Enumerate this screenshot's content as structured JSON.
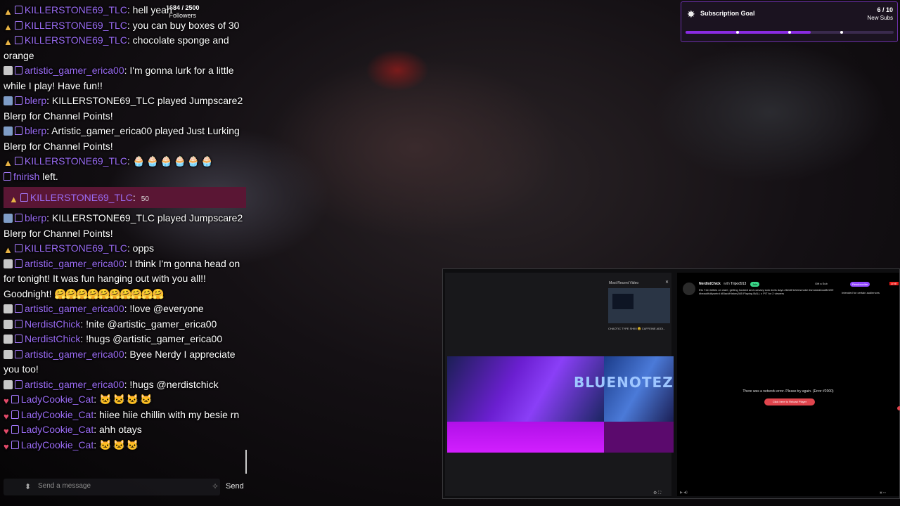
{
  "followers": {
    "count": "1684 / 2500",
    "label": "Followers"
  },
  "goal": {
    "title": "Subscription Goal",
    "count": "6 / 10",
    "label": "New Subs",
    "progress": 0.6
  },
  "chat": {
    "m1": {
      "name": "KILLERSTONE69_TLC",
      "text": ": hell yeah"
    },
    "m2": {
      "name": "KILLERSTONE69_TLC",
      "text": ": you can buy boxes of 30"
    },
    "m3": {
      "name": "KILLERSTONE69_TLC",
      "text": ": chocolate sponge and orange"
    },
    "m4": {
      "name": "artistic_gamer_erica00",
      "text": ": I'm gonna lurk for a little while I play! Have fun!!"
    },
    "m5": {
      "name": "blerp",
      "text": ": KILLERSTONE69_TLC played Jumpscare2 Blerp for Channel Points!"
    },
    "m6": {
      "name": "blerp",
      "text": ": Artistic_gamer_erica00 played Just Lurking Blerp for Channel Points!"
    },
    "m7": {
      "name": "KILLERSTONE69_TLC",
      "text": ":",
      "emotes": "🧁🧁🧁🧁🧁🧁"
    },
    "m8": {
      "name": "fnirish",
      "text": " left."
    },
    "hl": {
      "name": "KILLERSTONE69_TLC",
      "text": ":",
      "amount": "50"
    },
    "m9": {
      "name": "blerp",
      "text": ": KILLERSTONE69_TLC played Jumpscare2 Blerp for Channel Points!"
    },
    "m10": {
      "name": "KILLERSTONE69_TLC",
      "text": ": opps"
    },
    "m11": {
      "name": "artistic_gamer_erica00",
      "text": ": I think I'm gonna head on for tonight! It was fun hanging out with you all!! Goodnight!",
      "emotes": "🤗🤗🤗🤗🤗🤗🤗🤗🤗🤗"
    },
    "m12": {
      "name": "artistic_gamer_erica00",
      "text": ": !love @everyone"
    },
    "m13": {
      "name": "NerdistChick",
      "text": ": !nite @artistic_gamer_erica00"
    },
    "m14": {
      "name": "NerdistChick",
      "text": ": !hugs @artistic_gamer_erica00"
    },
    "m15": {
      "name": "artistic_gamer_erica00",
      "text": ": Byee Nerdy I appreciate you too!"
    },
    "m16": {
      "name": "artistic_gamer_erica00",
      "text": ": !hugs @nerdistchick"
    },
    "m17": {
      "name": "LadyCookie_Cat",
      "text": ":",
      "emotes": "🐱🐱🐱🐱"
    },
    "m18": {
      "name": "LadyCookie_Cat",
      "text": ": hiiee hiie chillin with my besie rn"
    },
    "m19": {
      "name": "LadyCookie_Cat",
      "text": ": ahh otays"
    },
    "m20": {
      "name": "LadyCookie_Cat",
      "text": ":",
      "emotes": "🐱🐱🐱"
    }
  },
  "input": {
    "placeholder": "Send a message",
    "send": "Send"
  },
  "browser": {
    "recent_label": "Most Recent Video",
    "recent_caption": "CHAOTIC TYPE SHIIII 😵 CAFFEINE ADDI...",
    "banner_text": "BLUENOTEZ",
    "channel": "NerdistChick",
    "with": "with",
    "partner": "Tripod913",
    "pill1": "Join",
    "desc": "Ets 7111 kilties on clan!, getting hooked and cursacy solo doris days #bestfrichensmoke #smokeabout82209 #beautifullyweird #BlackHistory365 Playing BALL x PIT for 2 viewers",
    "gift": "Gift a Sub",
    "resub": "Resubscribe",
    "live": "LIVE",
    "audience": "Intended for certain audiences",
    "error": "There was a network error. Please try again. (Error #2000)",
    "retry": "Click here to Reload Player"
  }
}
